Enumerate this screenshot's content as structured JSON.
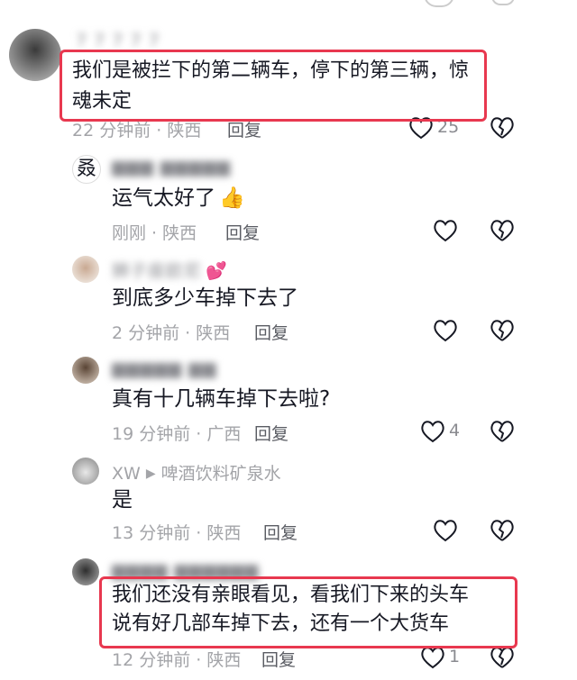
{
  "comments": [
    {
      "name": "7 7 7 7 7",
      "text_lines": [
        "我们是被拦下的第二辆车，停下的第三辆，惊",
        "魂未定"
      ],
      "meta": "22 分钟前 · 陕西",
      "reply": "回复",
      "likes": "25",
      "highlighted": true
    },
    {
      "name": "▆▆▆ ▆▆▆▆▆",
      "text": "运气太好了",
      "emoji": "👍",
      "meta": "刚刚 · 陕西",
      "reply": "回复",
      "likes": ""
    },
    {
      "name": "狮子座欧尼",
      "text": "到底多少车掉下去了",
      "meta": "2 分钟前 · 陕西",
      "reply": "回复",
      "likes": ""
    },
    {
      "name": "▆▆▆▆▆ ▆▆",
      "text": "真有十几辆车掉下去啦?",
      "meta": "19 分钟前 · 广西",
      "reply": "回复",
      "likes": "4"
    },
    {
      "name": "XW",
      "reply_to": "啤酒饮料矿泉水",
      "text": "是",
      "meta": "13 分钟前 · 陕西",
      "reply": "回复",
      "likes": ""
    },
    {
      "name": "▆▆▆▆ ▆▆▆▆▆▆",
      "text_lines": [
        "我们还没有亲眼看见，看我们下来的头车",
        "说有好几部车掉下去，还有一个大货车"
      ],
      "meta": "12 分钟前 · 陕西",
      "reply": "回复",
      "likes": "1",
      "highlighted": true
    }
  ],
  "colors": {
    "highlight": "#e8384f",
    "meta": "#a3a4a8",
    "text": "#161823"
  },
  "icons": {
    "like": "heart-outline-icon",
    "dislike": "broken-heart-icon"
  }
}
